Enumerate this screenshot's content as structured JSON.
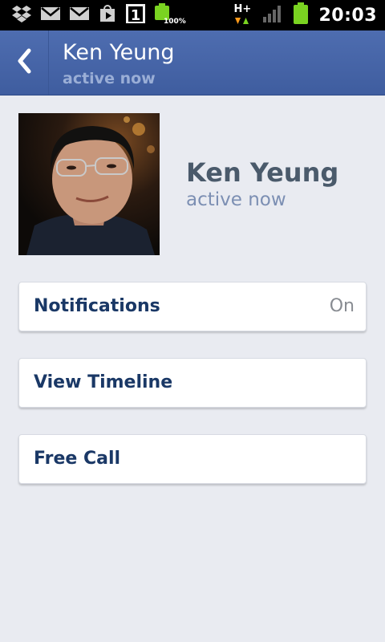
{
  "status_bar": {
    "time": "20:03",
    "battery_label": "100%",
    "notification_badge": "1",
    "network_type": "H+",
    "icons": [
      "dropbox-icon",
      "gmail-icon",
      "gmail-icon",
      "play-store-icon",
      "calendar-icon",
      "battery-icon",
      "network-activity-icon",
      "signal-icon",
      "battery-full-icon"
    ],
    "battery_color": "#7ad321"
  },
  "header": {
    "name": "Ken Yeung",
    "status": "active now",
    "back_icon": "chevron-left-icon",
    "background": "#4566a8"
  },
  "profile": {
    "name": "Ken Yeung",
    "status": "active now"
  },
  "rows": [
    {
      "label": "Notifications",
      "value": "On"
    },
    {
      "label": "View Timeline"
    },
    {
      "label": "Free Call"
    }
  ]
}
